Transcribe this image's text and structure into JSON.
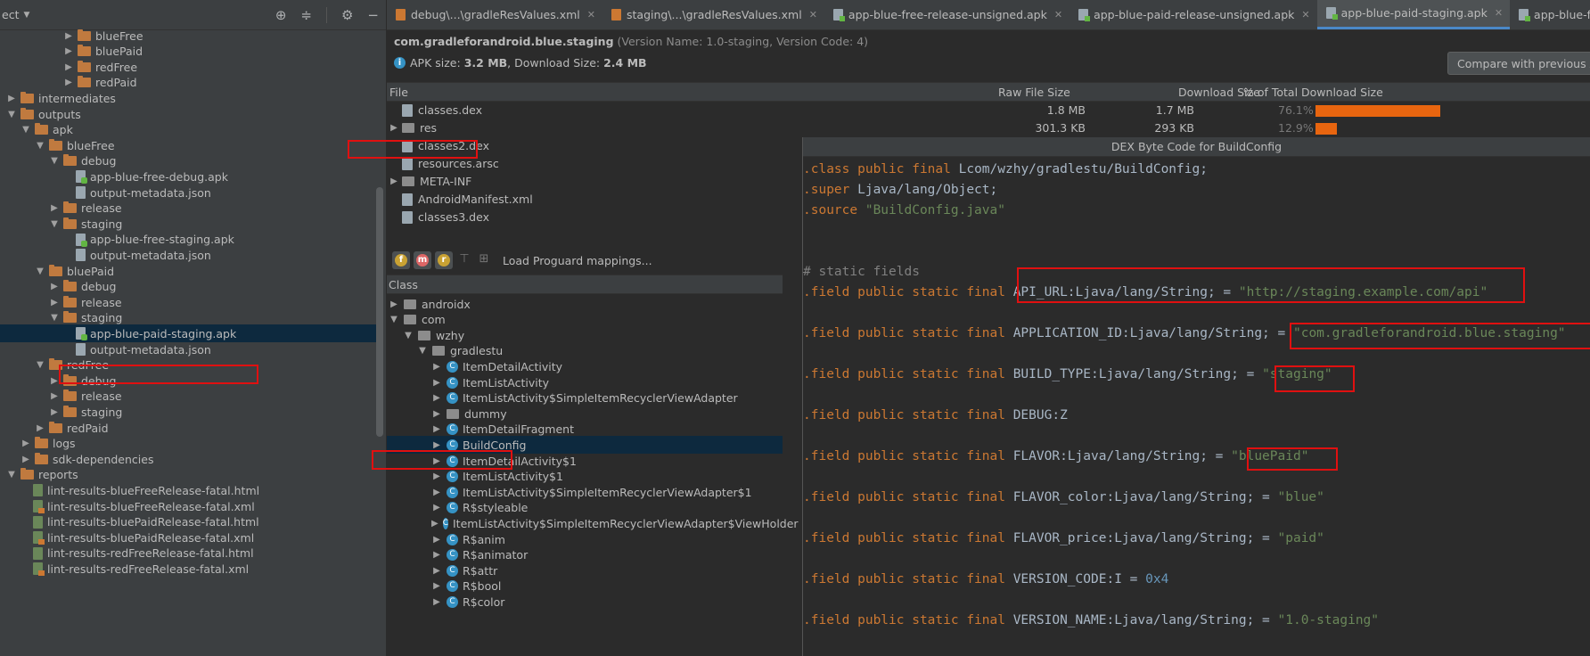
{
  "project_tree": {
    "title": "ect",
    "items": [
      {
        "label": "blueFree",
        "indent": 4,
        "arrow": "▶",
        "icon": "folder"
      },
      {
        "label": "bluePaid",
        "indent": 4,
        "arrow": "▶",
        "icon": "folder"
      },
      {
        "label": "redFree",
        "indent": 4,
        "arrow": "▶",
        "icon": "folder"
      },
      {
        "label": "redPaid",
        "indent": 4,
        "arrow": "▶",
        "icon": "folder"
      },
      {
        "label": "intermediates",
        "indent": 0,
        "arrow": "▶",
        "icon": "folder"
      },
      {
        "label": "outputs",
        "indent": 0,
        "arrow": "▼",
        "icon": "folder"
      },
      {
        "label": "apk",
        "indent": 1,
        "arrow": "▼",
        "icon": "folder"
      },
      {
        "label": "blueFree",
        "indent": 2,
        "arrow": "▼",
        "icon": "folder"
      },
      {
        "label": "debug",
        "indent": 3,
        "arrow": "▼",
        "icon": "folder"
      },
      {
        "label": "app-blue-free-debug.apk",
        "indent": 4,
        "arrow": "",
        "icon": "apk"
      },
      {
        "label": "output-metadata.json",
        "indent": 4,
        "arrow": "",
        "icon": "json"
      },
      {
        "label": "release",
        "indent": 3,
        "arrow": "▶",
        "icon": "folder"
      },
      {
        "label": "staging",
        "indent": 3,
        "arrow": "▼",
        "icon": "folder"
      },
      {
        "label": "app-blue-free-staging.apk",
        "indent": 4,
        "arrow": "",
        "icon": "apk"
      },
      {
        "label": "output-metadata.json",
        "indent": 4,
        "arrow": "",
        "icon": "json"
      },
      {
        "label": "bluePaid",
        "indent": 2,
        "arrow": "▼",
        "icon": "folder"
      },
      {
        "label": "debug",
        "indent": 3,
        "arrow": "▶",
        "icon": "folder"
      },
      {
        "label": "release",
        "indent": 3,
        "arrow": "▶",
        "icon": "folder"
      },
      {
        "label": "staging",
        "indent": 3,
        "arrow": "▼",
        "icon": "folder"
      },
      {
        "label": "app-blue-paid-staging.apk",
        "indent": 4,
        "arrow": "",
        "icon": "apk",
        "selected": true
      },
      {
        "label": "output-metadata.json",
        "indent": 4,
        "arrow": "",
        "icon": "json"
      },
      {
        "label": "redFree",
        "indent": 2,
        "arrow": "▼",
        "icon": "folder"
      },
      {
        "label": "debug",
        "indent": 3,
        "arrow": "▶",
        "icon": "folder"
      },
      {
        "label": "release",
        "indent": 3,
        "arrow": "▶",
        "icon": "folder"
      },
      {
        "label": "staging",
        "indent": 3,
        "arrow": "▶",
        "icon": "folder"
      },
      {
        "label": "redPaid",
        "indent": 2,
        "arrow": "▶",
        "icon": "folder"
      },
      {
        "label": "logs",
        "indent": 1,
        "arrow": "▶",
        "icon": "folder"
      },
      {
        "label": "sdk-dependencies",
        "indent": 1,
        "arrow": "▶",
        "icon": "folder"
      },
      {
        "label": "reports",
        "indent": 0,
        "arrow": "▼",
        "icon": "folder"
      },
      {
        "label": "lint-results-blueFreeRelease-fatal.html",
        "indent": 1,
        "arrow": "",
        "icon": "html"
      },
      {
        "label": "lint-results-blueFreeRelease-fatal.xml",
        "indent": 1,
        "arrow": "",
        "icon": "xml"
      },
      {
        "label": "lint-results-bluePaidRelease-fatal.html",
        "indent": 1,
        "arrow": "",
        "icon": "html"
      },
      {
        "label": "lint-results-bluePaidRelease-fatal.xml",
        "indent": 1,
        "arrow": "",
        "icon": "xml"
      },
      {
        "label": "lint-results-redFreeRelease-fatal.html",
        "indent": 1,
        "arrow": "",
        "icon": "html"
      },
      {
        "label": "lint-results-redFreeRelease-fatal.xml",
        "indent": 1,
        "arrow": "",
        "icon": "xml"
      }
    ]
  },
  "tabs": [
    {
      "label": "debug\\...\\gradleResValues.xml",
      "icon": "xml"
    },
    {
      "label": "staging\\...\\gradleResValues.xml",
      "icon": "xml"
    },
    {
      "label": "app-blue-free-release-unsigned.apk",
      "icon": "apk"
    },
    {
      "label": "app-blue-paid-release-unsigned.apk",
      "icon": "apk"
    },
    {
      "label": "app-blue-paid-staging.apk",
      "icon": "apk",
      "active": true
    },
    {
      "label": "app-blue-free-debug.",
      "icon": "apk"
    }
  ],
  "apk": {
    "package": "com.gradleforandroid.blue.staging",
    "version_info": "(Version Name: 1.0-staging, Version Code: 4)",
    "size_label": "APK size:",
    "size_value": "3.2 MB",
    "sep": ", Download Size:",
    "download_value": "2.4 MB",
    "compare_button": "Compare with previous A"
  },
  "file_table": {
    "headers": {
      "file": "File",
      "raw": "Raw File Size",
      "download": "Download Size",
      "pct": "% of Total Download Size"
    },
    "rows": [
      {
        "name": "classes.dex",
        "arrow": "",
        "icon": "dex",
        "raw": "1.8 MB",
        "download": "1.7 MB",
        "pct": "76.1%",
        "fraction": 0.761
      },
      {
        "name": "res",
        "arrow": "▶",
        "icon": "dir",
        "raw": "301.3 KB",
        "download": "293 KB",
        "pct": "12.9%",
        "fraction": 0.129
      },
      {
        "name": "classes2.dex",
        "arrow": "",
        "icon": "dex",
        "selected": true
      },
      {
        "name": "resources.arsc",
        "arrow": "",
        "icon": "dex"
      },
      {
        "name": "META-INF",
        "arrow": "▶",
        "icon": "dir"
      },
      {
        "name": "AndroidManifest.xml",
        "arrow": "",
        "icon": "dex"
      },
      {
        "name": "classes3.dex",
        "arrow": "",
        "icon": "dex"
      }
    ]
  },
  "dex_toolbar": {
    "proguard_label": "Load Proguard mappings..."
  },
  "class_tree": {
    "header": "Class",
    "items": [
      {
        "label": "androidx",
        "indent": 0,
        "arrow": "▶",
        "icon": "pkg"
      },
      {
        "label": "com",
        "indent": 0,
        "arrow": "▼",
        "icon": "pkg"
      },
      {
        "label": "wzhy",
        "indent": 1,
        "arrow": "▼",
        "icon": "pkg"
      },
      {
        "label": "gradlestu",
        "indent": 2,
        "arrow": "▼",
        "icon": "pkg"
      },
      {
        "label": "ItemDetailActivity",
        "indent": 3,
        "arrow": "▶",
        "icon": "class"
      },
      {
        "label": "ItemListActivity",
        "indent": 3,
        "arrow": "▶",
        "icon": "class"
      },
      {
        "label": "ItemListActivity$SimpleItemRecyclerViewAdapter",
        "indent": 3,
        "arrow": "▶",
        "icon": "class"
      },
      {
        "label": "dummy",
        "indent": 3,
        "arrow": "▶",
        "icon": "pkg"
      },
      {
        "label": "ItemDetailFragment",
        "indent": 3,
        "arrow": "▶",
        "icon": "class"
      },
      {
        "label": "BuildConfig",
        "indent": 3,
        "arrow": "▶",
        "icon": "class",
        "selected": true
      },
      {
        "label": "ItemDetailActivity$1",
        "indent": 3,
        "arrow": "▶",
        "icon": "class"
      },
      {
        "label": "ItemListActivity$1",
        "indent": 3,
        "arrow": "▶",
        "icon": "class"
      },
      {
        "label": "ItemListActivity$SimpleItemRecyclerViewAdapter$1",
        "indent": 3,
        "arrow": "▶",
        "icon": "class"
      },
      {
        "label": "R$styleable",
        "indent": 3,
        "arrow": "▶",
        "icon": "class"
      },
      {
        "label": "ItemListActivity$SimpleItemRecyclerViewAdapter$ViewHolder",
        "indent": 3,
        "arrow": "▶",
        "icon": "class"
      },
      {
        "label": "R$anim",
        "indent": 3,
        "arrow": "▶",
        "icon": "class"
      },
      {
        "label": "R$animator",
        "indent": 3,
        "arrow": "▶",
        "icon": "class"
      },
      {
        "label": "R$attr",
        "indent": 3,
        "arrow": "▶",
        "icon": "class"
      },
      {
        "label": "R$bool",
        "indent": 3,
        "arrow": "▶",
        "icon": "class"
      },
      {
        "label": "R$color",
        "indent": 3,
        "arrow": "▶",
        "icon": "class"
      }
    ]
  },
  "bytecode": {
    "title": "DEX Byte Code for BuildConfig",
    "lines": [
      [
        {
          "t": ".class public final ",
          "c": "kw"
        },
        {
          "t": "Lcom/wzhy/gradlestu/BuildConfig;",
          "c": ""
        }
      ],
      [
        {
          "t": ".super ",
          "c": "kw"
        },
        {
          "t": "Ljava/lang/Object;",
          "c": ""
        }
      ],
      [
        {
          "t": ".source ",
          "c": "kw"
        },
        {
          "t": "\"BuildConfig.java\"",
          "c": "st"
        }
      ],
      [],
      [],
      [
        {
          "t": "# static fields",
          "c": "cm"
        }
      ],
      [
        {
          "t": ".field public static final ",
          "c": "kw"
        },
        {
          "t": "API_URL:Ljava/lang/String; = ",
          "c": ""
        },
        {
          "t": "\"http://staging.example.com/api\"",
          "c": "st"
        }
      ],
      [],
      [
        {
          "t": ".field public static final ",
          "c": "kw"
        },
        {
          "t": "APPLICATION_ID:Ljava/lang/String; = ",
          "c": ""
        },
        {
          "t": "\"com.gradleforandroid.blue.staging\"",
          "c": "st"
        }
      ],
      [],
      [
        {
          "t": ".field public static final ",
          "c": "kw"
        },
        {
          "t": "BUILD_TYPE:Ljava/lang/String; = ",
          "c": ""
        },
        {
          "t": "\"staging\"",
          "c": "st"
        }
      ],
      [],
      [
        {
          "t": ".field public static final ",
          "c": "kw"
        },
        {
          "t": "DEBUG:Z",
          "c": ""
        }
      ],
      [],
      [
        {
          "t": ".field public static final ",
          "c": "kw"
        },
        {
          "t": "FLAVOR:Ljava/lang/String; = ",
          "c": ""
        },
        {
          "t": "\"bluePaid\"",
          "c": "st"
        }
      ],
      [],
      [
        {
          "t": ".field public static final ",
          "c": "kw"
        },
        {
          "t": "FLAVOR_color:Ljava/lang/String; = ",
          "c": ""
        },
        {
          "t": "\"blue\"",
          "c": "st"
        }
      ],
      [],
      [
        {
          "t": ".field public static final ",
          "c": "kw"
        },
        {
          "t": "FLAVOR_price:Ljava/lang/String; = ",
          "c": ""
        },
        {
          "t": "\"paid\"",
          "c": "st"
        }
      ],
      [],
      [
        {
          "t": ".field public static final ",
          "c": "kw"
        },
        {
          "t": "VERSION_CODE:I = ",
          "c": ""
        },
        {
          "t": "0x4",
          "c": "nu"
        }
      ],
      [],
      [
        {
          "t": ".field public static final ",
          "c": "kw"
        },
        {
          "t": "VERSION_NAME:Ljava/lang/String; = ",
          "c": ""
        },
        {
          "t": "\"1.0-staging\"",
          "c": "st"
        }
      ]
    ]
  },
  "colors": {
    "highlight": "#e01010",
    "selection": "#0d293e",
    "bar": "#e8650f"
  }
}
